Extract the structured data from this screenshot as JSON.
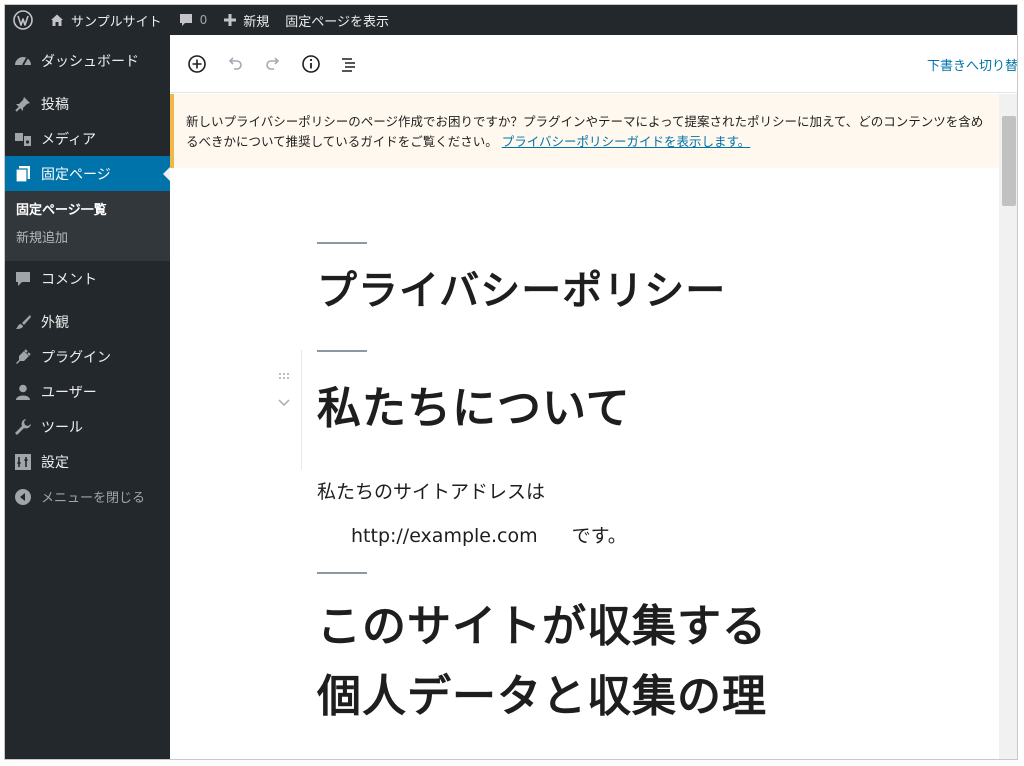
{
  "adminbar": {
    "site_name": "サンプルサイト",
    "comments_count": "0",
    "new_label": "新規",
    "view_page": "固定ページを表示"
  },
  "sidebar": {
    "items": [
      {
        "label": "ダッシュボード",
        "icon": "dashboard-icon"
      },
      {
        "label": "投稿",
        "icon": "pin-icon"
      },
      {
        "label": "メディア",
        "icon": "media-icon"
      },
      {
        "label": "固定ページ",
        "icon": "pages-icon",
        "active": true
      },
      {
        "label": "コメント",
        "icon": "comment-icon"
      },
      {
        "label": "外観",
        "icon": "brush-icon"
      },
      {
        "label": "プラグイン",
        "icon": "plugin-icon"
      },
      {
        "label": "ユーザー",
        "icon": "user-icon"
      },
      {
        "label": "ツール",
        "icon": "wrench-icon"
      },
      {
        "label": "設定",
        "icon": "settings-icon"
      }
    ],
    "submenu": [
      "固定ページ一覧",
      "新規追加"
    ],
    "collapse_label": "メニューを閉じる"
  },
  "editor": {
    "switch_to_draft": "下書きへ切り替え"
  },
  "notice": {
    "text": "新しいプライバシーポリシーのページ作成でお困りですか？プラグインやテーマによって提案されたポリシーに加えて、どのコンテンツを含めるべきかについて推奨しているガイドをご覧ください。",
    "link": "プライバシーポリシーガイドを表示します。"
  },
  "post": {
    "title": "プライバシーポリシー",
    "heading1": "私たちについて",
    "para_prefix": "私たちのサイトアドレスは",
    "para_url": "http://example.com",
    "para_suffix": "です。",
    "heading2_line1": "このサイトが収集する",
    "heading2_line2": "個人データと収集の理"
  },
  "colors": {
    "admin_dark": "#23282d",
    "accent": "#0073aa",
    "notice_bg": "#fef8ee",
    "notice_border": "#f0b849"
  }
}
